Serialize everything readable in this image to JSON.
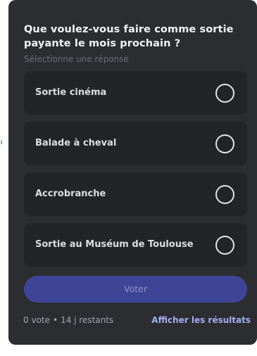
{
  "poll": {
    "question": "Que voulez-vous faire comme sortie payante le mois prochain ?",
    "hint": "Sélectionne une réponse",
    "answers": [
      {
        "label": "Sortie cinéma",
        "icon": "radio-unchecked-icon"
      },
      {
        "label": "Balade à cheval",
        "icon": "radio-unchecked-icon"
      },
      {
        "label": "Accrobranche",
        "icon": "radio-unchecked-icon"
      },
      {
        "label": "Sortie au Muséum de Toulouse",
        "icon": "radio-unchecked-icon"
      }
    ],
    "vote_label": "Voter",
    "votes_text": "0 vote",
    "separator": "•",
    "remaining_text": "14 j restants",
    "results_label": "Afficher les résultats"
  },
  "colors": {
    "card_bg": "#2b2d31",
    "answer_bg": "#232428",
    "question_text": "#f2f3f5",
    "hint_text": "#6d6f78",
    "vote_button_bg": "#3f4596",
    "vote_button_text": "#8e93c7",
    "results_link": "#a6acf2"
  }
}
